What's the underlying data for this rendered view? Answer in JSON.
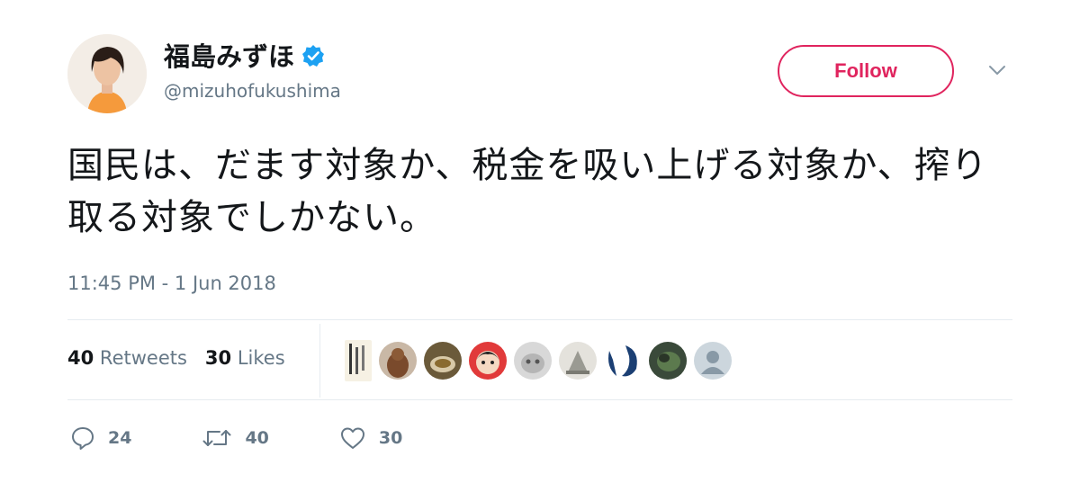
{
  "author": {
    "display_name": "福島みずほ",
    "handle": "@mizuhofukushima",
    "verified": true
  },
  "header": {
    "follow_label": "Follow",
    "accent_color": "#e0245e",
    "verified_color": "#1da1f2"
  },
  "tweet": {
    "text": "国民は、だます対象か、税金を吸い上げる対象か、搾り取る対象でしかない。",
    "timestamp": "11:45 PM - 1 Jun 2018"
  },
  "stats": {
    "retweets_count": "40",
    "retweets_label": "Retweets",
    "likes_count": "30",
    "likes_label": "Likes"
  },
  "actions": {
    "reply_count": "24",
    "retweet_count": "40",
    "like_count": "30"
  },
  "icons": [
    "verified-badge-icon",
    "chevron-down-icon",
    "reply-icon",
    "retweet-icon",
    "heart-icon"
  ]
}
